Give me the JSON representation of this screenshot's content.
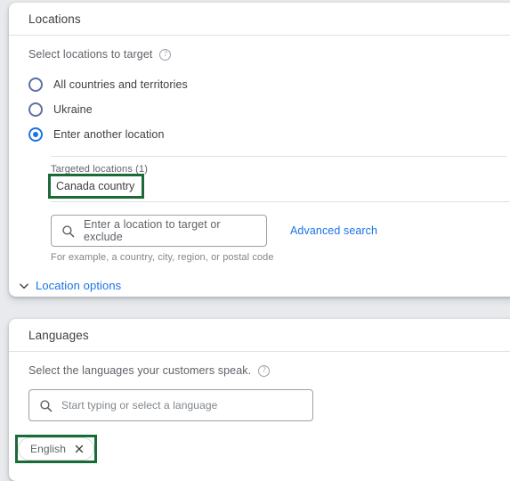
{
  "locations": {
    "title": "Locations",
    "section_label": "Select locations to target",
    "help_icon": "help-circle-icon",
    "options": [
      {
        "label": "All countries and territories",
        "selected": false
      },
      {
        "label": "Ukraine",
        "selected": false
      },
      {
        "label": "Enter another location",
        "selected": true
      }
    ],
    "targeted": {
      "heading": "Targeted locations (1)",
      "items": [
        "Canada country"
      ],
      "count": 1,
      "highlighted": true
    },
    "search": {
      "icon": "search-icon",
      "placeholder": "Enter a location to target or exclude",
      "value": "",
      "hint": "For example, a country, city, region, or postal code"
    },
    "advanced_search_label": "Advanced search",
    "location_options": {
      "label": "Location options",
      "icon": "chevron-down-icon",
      "expanded": false
    }
  },
  "languages": {
    "title": "Languages",
    "section_label": "Select the languages your customers speak.",
    "help_icon": "help-circle-icon",
    "search": {
      "icon": "search-icon",
      "placeholder": "Start typing or select a language",
      "value": ""
    },
    "chips": [
      {
        "label": "English",
        "remove_icon": "close-icon",
        "highlighted": true
      }
    ]
  },
  "colors": {
    "accent_blue": "#1a73e8",
    "highlight_green": "#1b6b38",
    "text_primary": "#3c4043",
    "text_secondary": "#5f6368",
    "border": "#dadce0",
    "page_bg": "#e8eaed",
    "card_bg": "#ffffff"
  }
}
